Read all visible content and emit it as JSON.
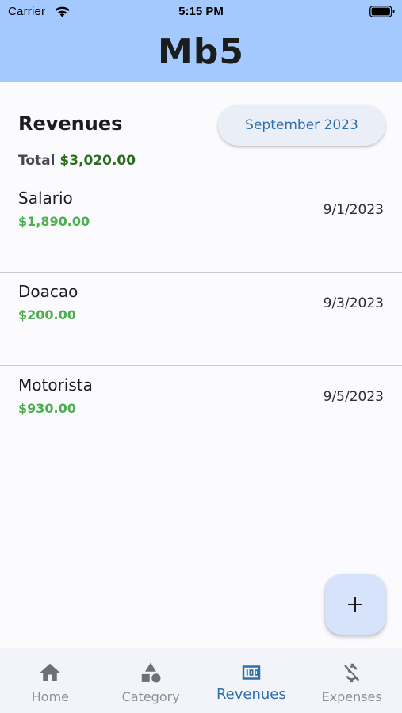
{
  "status_bar": {
    "carrier": "Carrier",
    "time": "5:15 PM"
  },
  "app_bar": {
    "title": "Mb5",
    "color": "#a3c9fe"
  },
  "revenues": {
    "title": "Revenues",
    "month_button_label": "September 2023",
    "total_label": "Total",
    "total_value": "$3,020.00",
    "items": [
      {
        "name": "Salario",
        "amount": "$1,890.00",
        "date": "9/1/2023"
      },
      {
        "name": "Doacao",
        "amount": "$200.00",
        "date": "9/3/2023"
      },
      {
        "name": "Motorista",
        "amount": "$930.00",
        "date": "9/5/2023"
      }
    ]
  },
  "fab": {
    "icon": "plus-icon"
  },
  "bottom_nav": {
    "items": [
      {
        "label": "Home",
        "icon": "home-icon"
      },
      {
        "label": "Category",
        "icon": "category-icon"
      },
      {
        "label": "Revenues",
        "icon": "money-icon",
        "active": true
      },
      {
        "label": "Expenses",
        "icon": "money-off-icon"
      }
    ]
  },
  "colors": {
    "accent": "#2f6fad",
    "positive_amount": "#4caf50",
    "total_amount": "#2e6b1f"
  }
}
